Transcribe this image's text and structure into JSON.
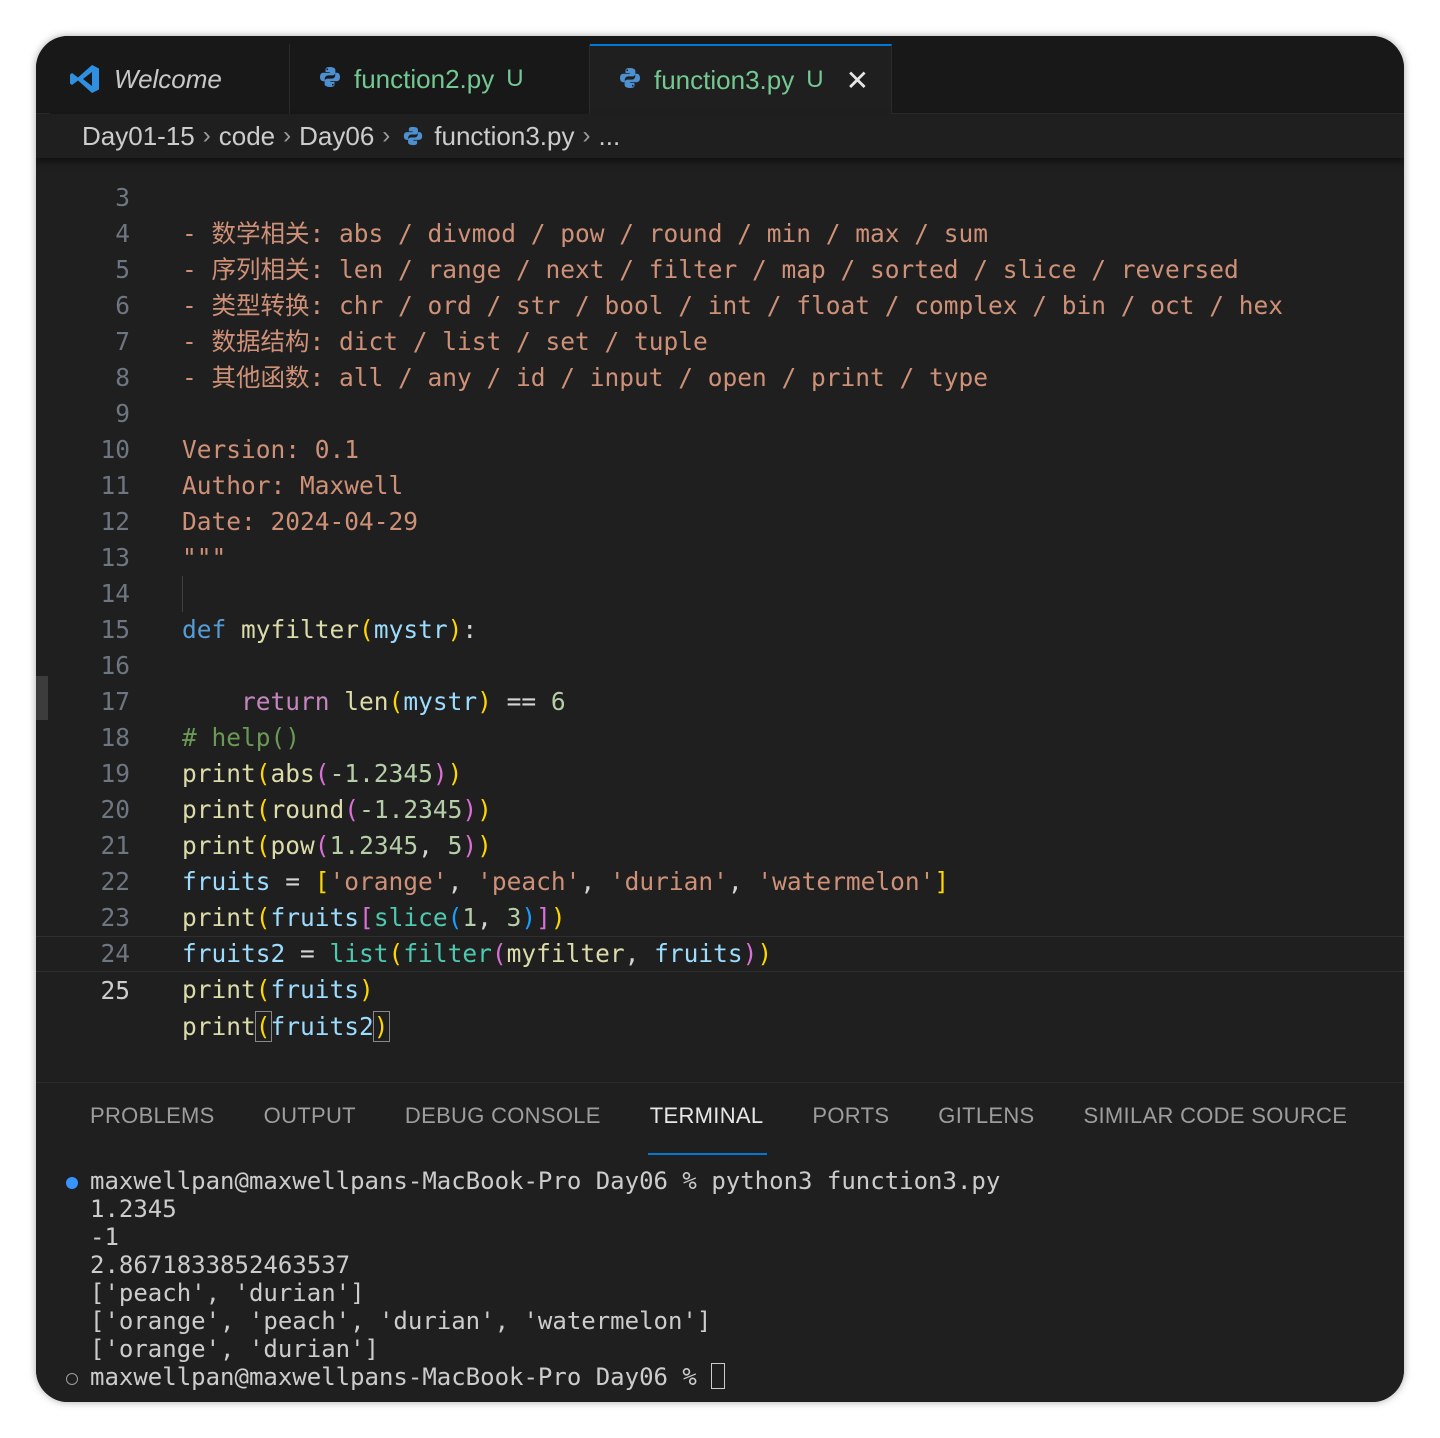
{
  "tabs": [
    {
      "label": "Welcome",
      "icon": "vscode-logo-icon"
    },
    {
      "label": "function2.py",
      "modified": "U",
      "icon": "python-icon"
    },
    {
      "label": "function3.py",
      "modified": "U",
      "icon": "python-icon",
      "close": "✕"
    }
  ],
  "breadcrumb": {
    "items": [
      "Day01-15",
      "code",
      "Day06",
      "function3.py",
      "..."
    ],
    "separator": "›"
  },
  "editor": {
    "current_line": "25",
    "lines": [
      {
        "n": "3",
        "text": "- 数学相关: abs / divmod / pow / round / min / max / sum"
      },
      {
        "n": "4",
        "text": "- 序列相关: len / range / next / filter / map / sorted / slice / reversed"
      },
      {
        "n": "5",
        "text": "- 类型转换: chr / ord / str / bool / int / float / complex / bin / oct / hex"
      },
      {
        "n": "6",
        "text": "- 数据结构: dict / list / set / tuple"
      },
      {
        "n": "7",
        "text": "- 其他函数: all / any / id / input / open / print / type"
      },
      {
        "n": "8",
        "text": ""
      },
      {
        "n": "9",
        "text": "Version: 0.1"
      },
      {
        "n": "10",
        "text": "Author: Maxwell"
      },
      {
        "n": "11",
        "text": "Date: 2024-04-29"
      },
      {
        "n": "12",
        "text": "\"\"\""
      },
      {
        "n": "13",
        "text": ""
      },
      {
        "n": "14",
        "tokens": [
          "def",
          " ",
          "myfilter",
          "(",
          "mystr",
          "):"
        ]
      },
      {
        "n": "15",
        "tokens": [
          "    ",
          "return",
          " ",
          "len",
          "(",
          "mystr",
          ")",
          " == ",
          "6"
        ]
      },
      {
        "n": "16",
        "text": ""
      },
      {
        "n": "17",
        "text": "# help()"
      },
      {
        "n": "18",
        "tokens": [
          "print",
          "(",
          "abs",
          "(",
          "-1.2345",
          ")",
          ")"
        ]
      },
      {
        "n": "19",
        "tokens": [
          "print",
          "(",
          "round",
          "(",
          "-1.2345",
          ")",
          ")"
        ]
      },
      {
        "n": "20",
        "tokens": [
          "print",
          "(",
          "pow",
          "(",
          "1.2345",
          ", ",
          "5",
          ")",
          ")"
        ]
      },
      {
        "n": "21",
        "tokens": [
          "fruits",
          " = ",
          "[",
          "'orange'",
          ", ",
          "'peach'",
          ", ",
          "'durian'",
          ", ",
          "'watermelon'",
          "]"
        ]
      },
      {
        "n": "22",
        "tokens": [
          "print",
          "(",
          "fruits",
          "[",
          "slice",
          "(",
          "1",
          ", ",
          "3",
          ")",
          "]",
          ")"
        ]
      },
      {
        "n": "23",
        "tokens": [
          "fruits2",
          " = ",
          "list",
          "(",
          "filter",
          "(",
          "myfilter",
          ", ",
          "fruits",
          ")",
          ")"
        ]
      },
      {
        "n": "24",
        "tokens": [
          "print",
          "(",
          "fruits",
          ")"
        ]
      },
      {
        "n": "25",
        "tokens": [
          "print",
          "(",
          "fruits2",
          ")"
        ]
      }
    ]
  },
  "panel": {
    "tabs": [
      "PROBLEMS",
      "OUTPUT",
      "DEBUG CONSOLE",
      "TERMINAL",
      "PORTS",
      "GITLENS",
      "SIMILAR CODE SOURCE"
    ],
    "active_tab": "TERMINAL",
    "terminal_lines": [
      "maxwellpan@maxwellpans-MacBook-Pro Day06 % python3 function3.py",
      "1.2345",
      "-1",
      "2.8671833852463537",
      "['peach', 'durian']",
      "['orange', 'peach', 'durian', 'watermelon']",
      "['orange', 'durian']",
      "maxwellpan@maxwellpans-MacBook-Pro Day06 % "
    ]
  },
  "colors": {
    "accent": "#0078d4",
    "modified": "#73c991",
    "editor_bg": "#1f1f1f",
    "string": "#ce9178",
    "keyword": "#569cd6",
    "function": "#dcdcaa"
  }
}
